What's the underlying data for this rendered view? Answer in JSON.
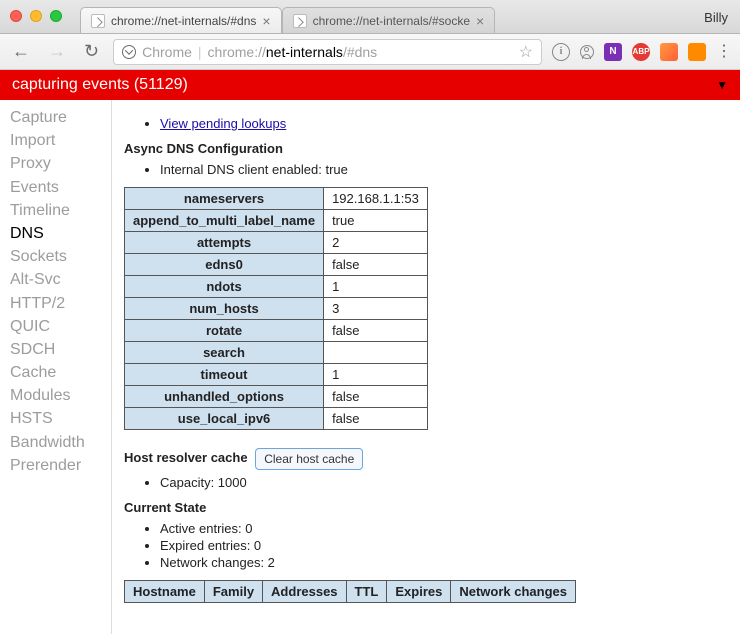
{
  "window": {
    "profile": "Billy"
  },
  "tabs": [
    {
      "title": "chrome://net-internals/#dns",
      "active": true
    },
    {
      "title": "chrome://net-internals/#socke",
      "active": false
    }
  ],
  "omnibox": {
    "scheme_label": "Chrome",
    "url_grey1": "chrome://",
    "url_black": "net-internals",
    "url_grey2": "/#dns"
  },
  "banner": {
    "text": "capturing events (51129)"
  },
  "sidebar": {
    "items": [
      "Capture",
      "Import",
      "Proxy",
      "Events",
      "Timeline",
      "DNS",
      "Sockets",
      "Alt-Svc",
      "HTTP/2",
      "QUIC",
      "SDCH",
      "Cache",
      "Modules",
      "HSTS",
      "Bandwidth",
      "Prerender"
    ],
    "active": "DNS"
  },
  "content": {
    "pending_link": "View pending lookups",
    "async_heading": "Async DNS Configuration",
    "internal_dns_line": "Internal DNS client enabled: true",
    "config_rows": [
      {
        "key": "nameservers",
        "value": "192.168.1.1:53"
      },
      {
        "key": "append_to_multi_label_name",
        "value": "true"
      },
      {
        "key": "attempts",
        "value": "2"
      },
      {
        "key": "edns0",
        "value": "false"
      },
      {
        "key": "ndots",
        "value": "1"
      },
      {
        "key": "num_hosts",
        "value": "3"
      },
      {
        "key": "rotate",
        "value": "false"
      },
      {
        "key": "search",
        "value": ""
      },
      {
        "key": "timeout",
        "value": "1"
      },
      {
        "key": "unhandled_options",
        "value": "false"
      },
      {
        "key": "use_local_ipv6",
        "value": "false"
      }
    ],
    "resolver_heading": "Host resolver cache",
    "clear_button": "Clear host cache",
    "capacity_line": "Capacity: 1000",
    "current_state_heading": "Current State",
    "state_bullets": [
      "Active entries: 0",
      "Expired entries: 0",
      "Network changes: 2"
    ],
    "state_columns": [
      "Hostname",
      "Family",
      "Addresses",
      "TTL",
      "Expires",
      "Network changes"
    ]
  }
}
